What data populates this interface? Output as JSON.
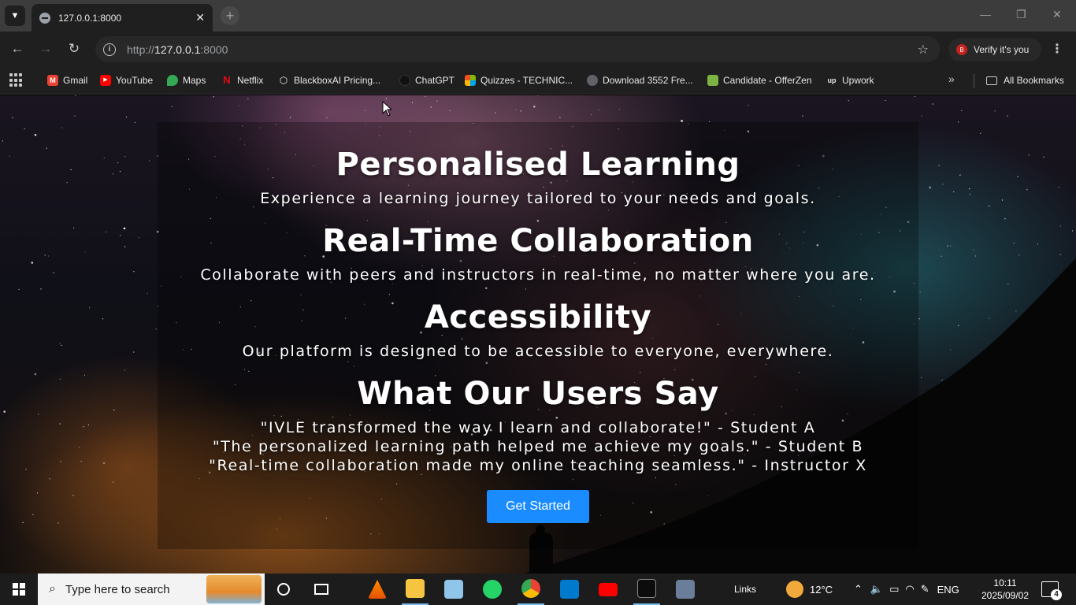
{
  "browser": {
    "tab": {
      "title": "127.0.0.1:8000",
      "close": "✕"
    },
    "new_tab": "+",
    "address": {
      "scheme": "http://",
      "host": "127.0.0.1",
      "port": ":8000"
    },
    "verify_label": "Verify it's you",
    "verify_avatar": "B",
    "window_controls": {
      "minimize": "—",
      "restore": "❐",
      "close": "✕"
    }
  },
  "bookmarks": {
    "items": [
      {
        "label": "Gmail",
        "icon": "gmail-icon",
        "color": "#ea4335",
        "glyph": "M"
      },
      {
        "label": "YouTube",
        "icon": "youtube-icon",
        "color": "#ff0000",
        "glyph": "▶"
      },
      {
        "label": "Maps",
        "icon": "maps-icon",
        "color": "#34a853",
        "glyph": "●"
      },
      {
        "label": "Netflix",
        "icon": "netflix-icon",
        "color": "#e50914",
        "glyph": "N"
      },
      {
        "label": "BlackboxAI Pricing...",
        "icon": "blackbox-icon",
        "color": "#1f1f1f",
        "glyph": "⬡"
      },
      {
        "label": "ChatGPT",
        "icon": "chatgpt-icon",
        "color": "#1f1f1f",
        "glyph": "◎"
      },
      {
        "label": "Quizzes - TECHNIC...",
        "icon": "microsoft-icon",
        "color": "#f25022",
        "glyph": "▦"
      },
      {
        "label": "Download 3552 Fre...",
        "icon": "globe-icon",
        "color": "#5f6368",
        "glyph": "◍"
      },
      {
        "label": "Candidate - OfferZen",
        "icon": "offerzen-icon",
        "color": "#7cb342",
        "glyph": "◆"
      },
      {
        "label": "Upwork",
        "icon": "upwork-icon",
        "color": "#1f1f1f",
        "glyph": "up"
      }
    ],
    "more": "»",
    "all_bookmarks": "All Bookmarks"
  },
  "page": {
    "sections": [
      {
        "heading": "Personalised Learning",
        "text": "Experience a learning journey tailored to your needs and goals."
      },
      {
        "heading": "Real-Time Collaboration",
        "text": "Collaborate with peers and instructors in real-time, no matter where you are."
      },
      {
        "heading": "Accessibility",
        "text": "Our platform is designed to be accessible to everyone, everywhere."
      }
    ],
    "testimonials": {
      "heading": "What Our Users Say",
      "quotes": [
        "\"IVLE transformed the way I learn and collaborate!\" - Student A",
        "\"The personalized learning path helped me achieve my goals.\" - Student B",
        "\"Real-time collaboration made my online teaching seamless.\" - Instructor X"
      ]
    },
    "cta_label": "Get Started",
    "accent_color": "#1a8cff"
  },
  "taskbar": {
    "search_placeholder": "Type here to search",
    "links_label": "Links",
    "weather": "12°C",
    "language": "ENG",
    "time": "10:11",
    "date": "2025/09/02",
    "notification_count": "4"
  }
}
